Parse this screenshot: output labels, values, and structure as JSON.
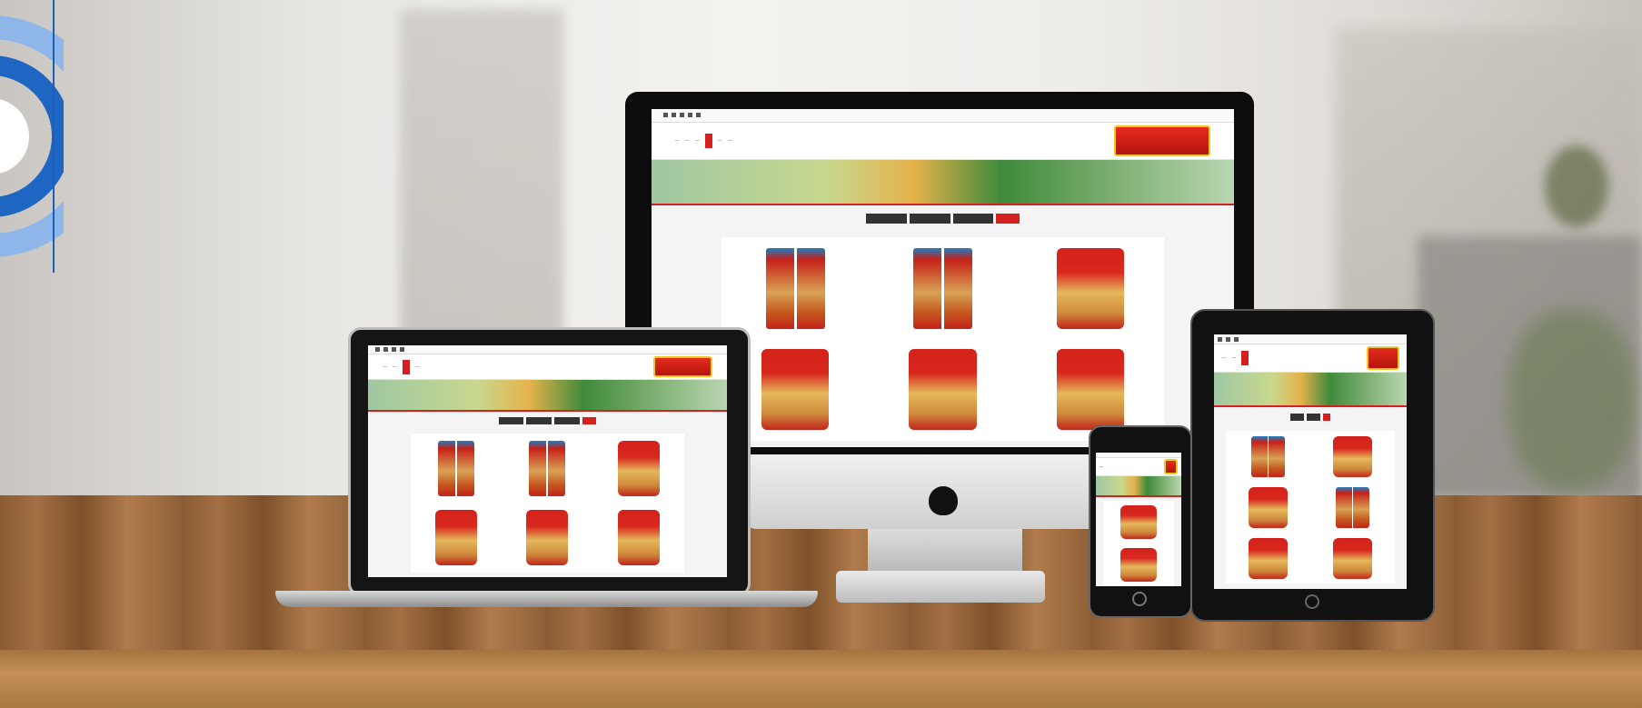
{
  "scene": {
    "description_devices": [
      "imac",
      "laptop",
      "tablet",
      "phone"
    ],
    "website_mock": {
      "accent_color": "#d4201f",
      "product_count_desktop": 6
    }
  }
}
